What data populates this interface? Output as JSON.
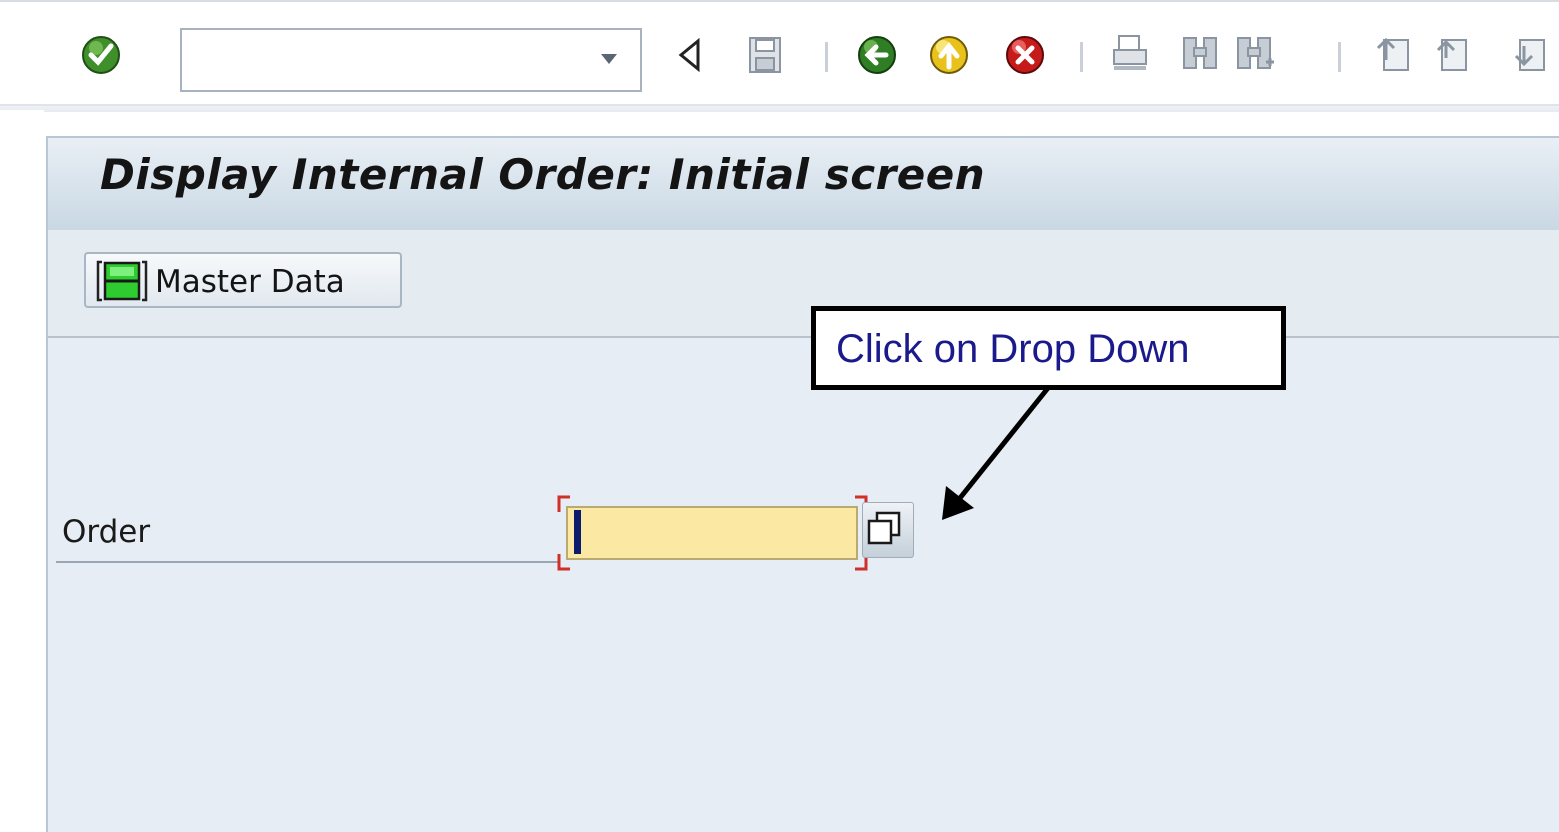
{
  "toolbar": {
    "command_field_value": "",
    "icons": [
      "enter-check-icon",
      "command-dropdown-icon",
      "collapse-arrow-icon",
      "save-icon",
      "back-icon",
      "exit-icon",
      "cancel-icon",
      "print-icon",
      "find-icon",
      "find-next-icon",
      "first-page-icon",
      "previous-page-icon",
      "next-page-icon"
    ]
  },
  "title": "Display Internal Order: Initial screen",
  "app_toolbar": {
    "master_data_label": "Master Data"
  },
  "form": {
    "order_label": "Order",
    "order_value": ""
  },
  "callout": {
    "text": "Click on Drop Down"
  },
  "colors": {
    "title_bg": "#d7e2ec",
    "input_required_bg": "#fbe9a3",
    "callout_text": "#1a1a8c",
    "main_bg": "#e6edf4"
  }
}
